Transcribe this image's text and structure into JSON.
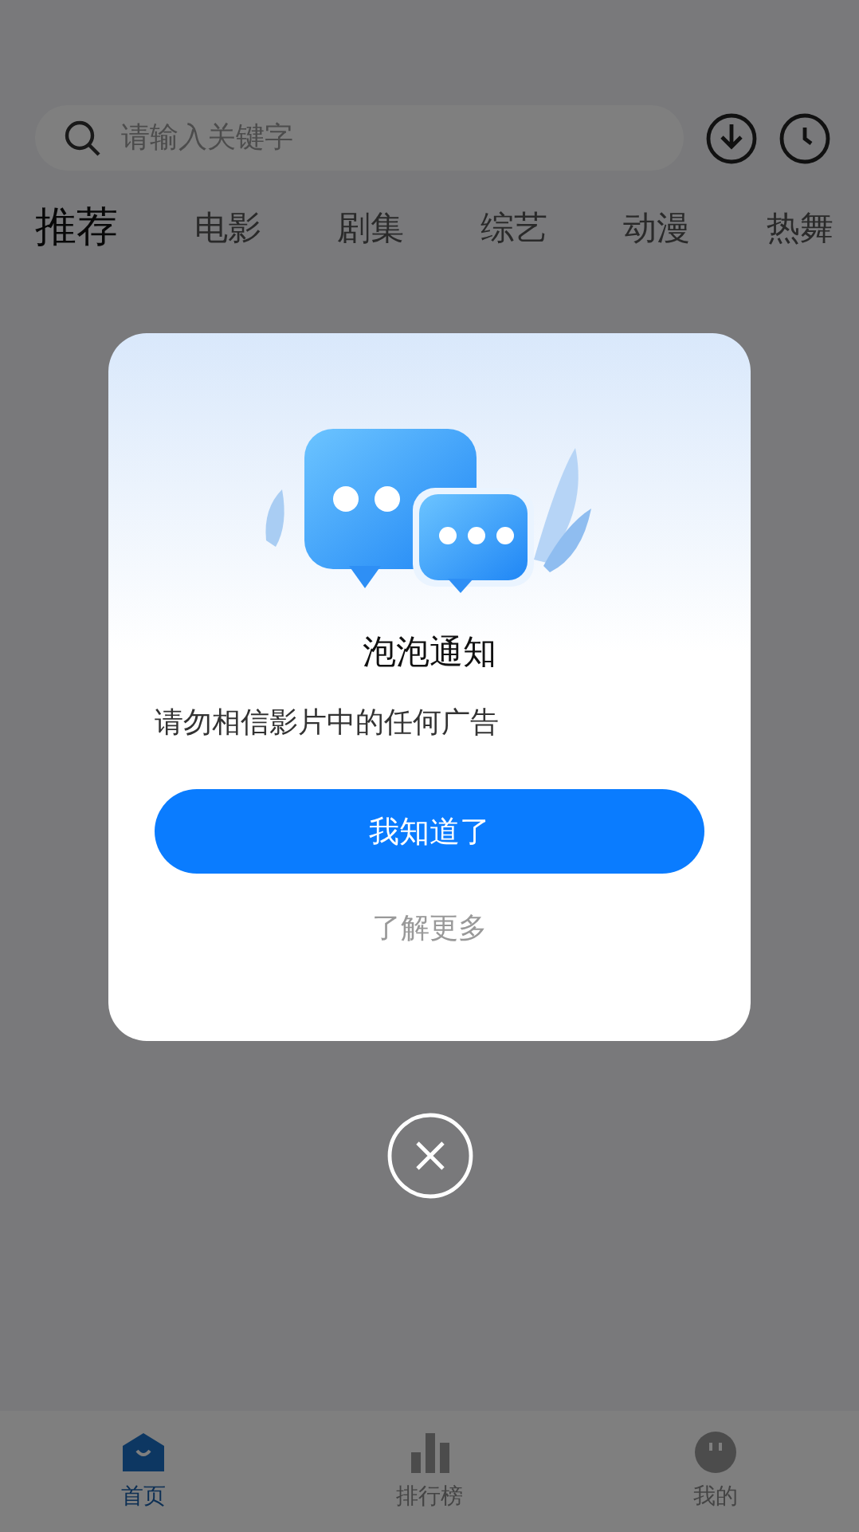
{
  "search": {
    "placeholder": "请输入关键字"
  },
  "tabs": [
    {
      "label": "推荐",
      "selected": true
    },
    {
      "label": "电影",
      "selected": false
    },
    {
      "label": "剧集",
      "selected": false
    },
    {
      "label": "综艺",
      "selected": false
    },
    {
      "label": "动漫",
      "selected": false
    },
    {
      "label": "热舞",
      "selected": false
    }
  ],
  "dialog": {
    "title": "泡泡通知",
    "message": "请勿相信影片中的任何广告",
    "primary_button": "我知道了",
    "secondary_link": "了解更多"
  },
  "bottom_nav": [
    {
      "label": "首页",
      "kind": "home",
      "selected": true
    },
    {
      "label": "排行榜",
      "kind": "rank",
      "selected": false
    },
    {
      "label": "我的",
      "kind": "profile",
      "selected": false
    }
  ]
}
